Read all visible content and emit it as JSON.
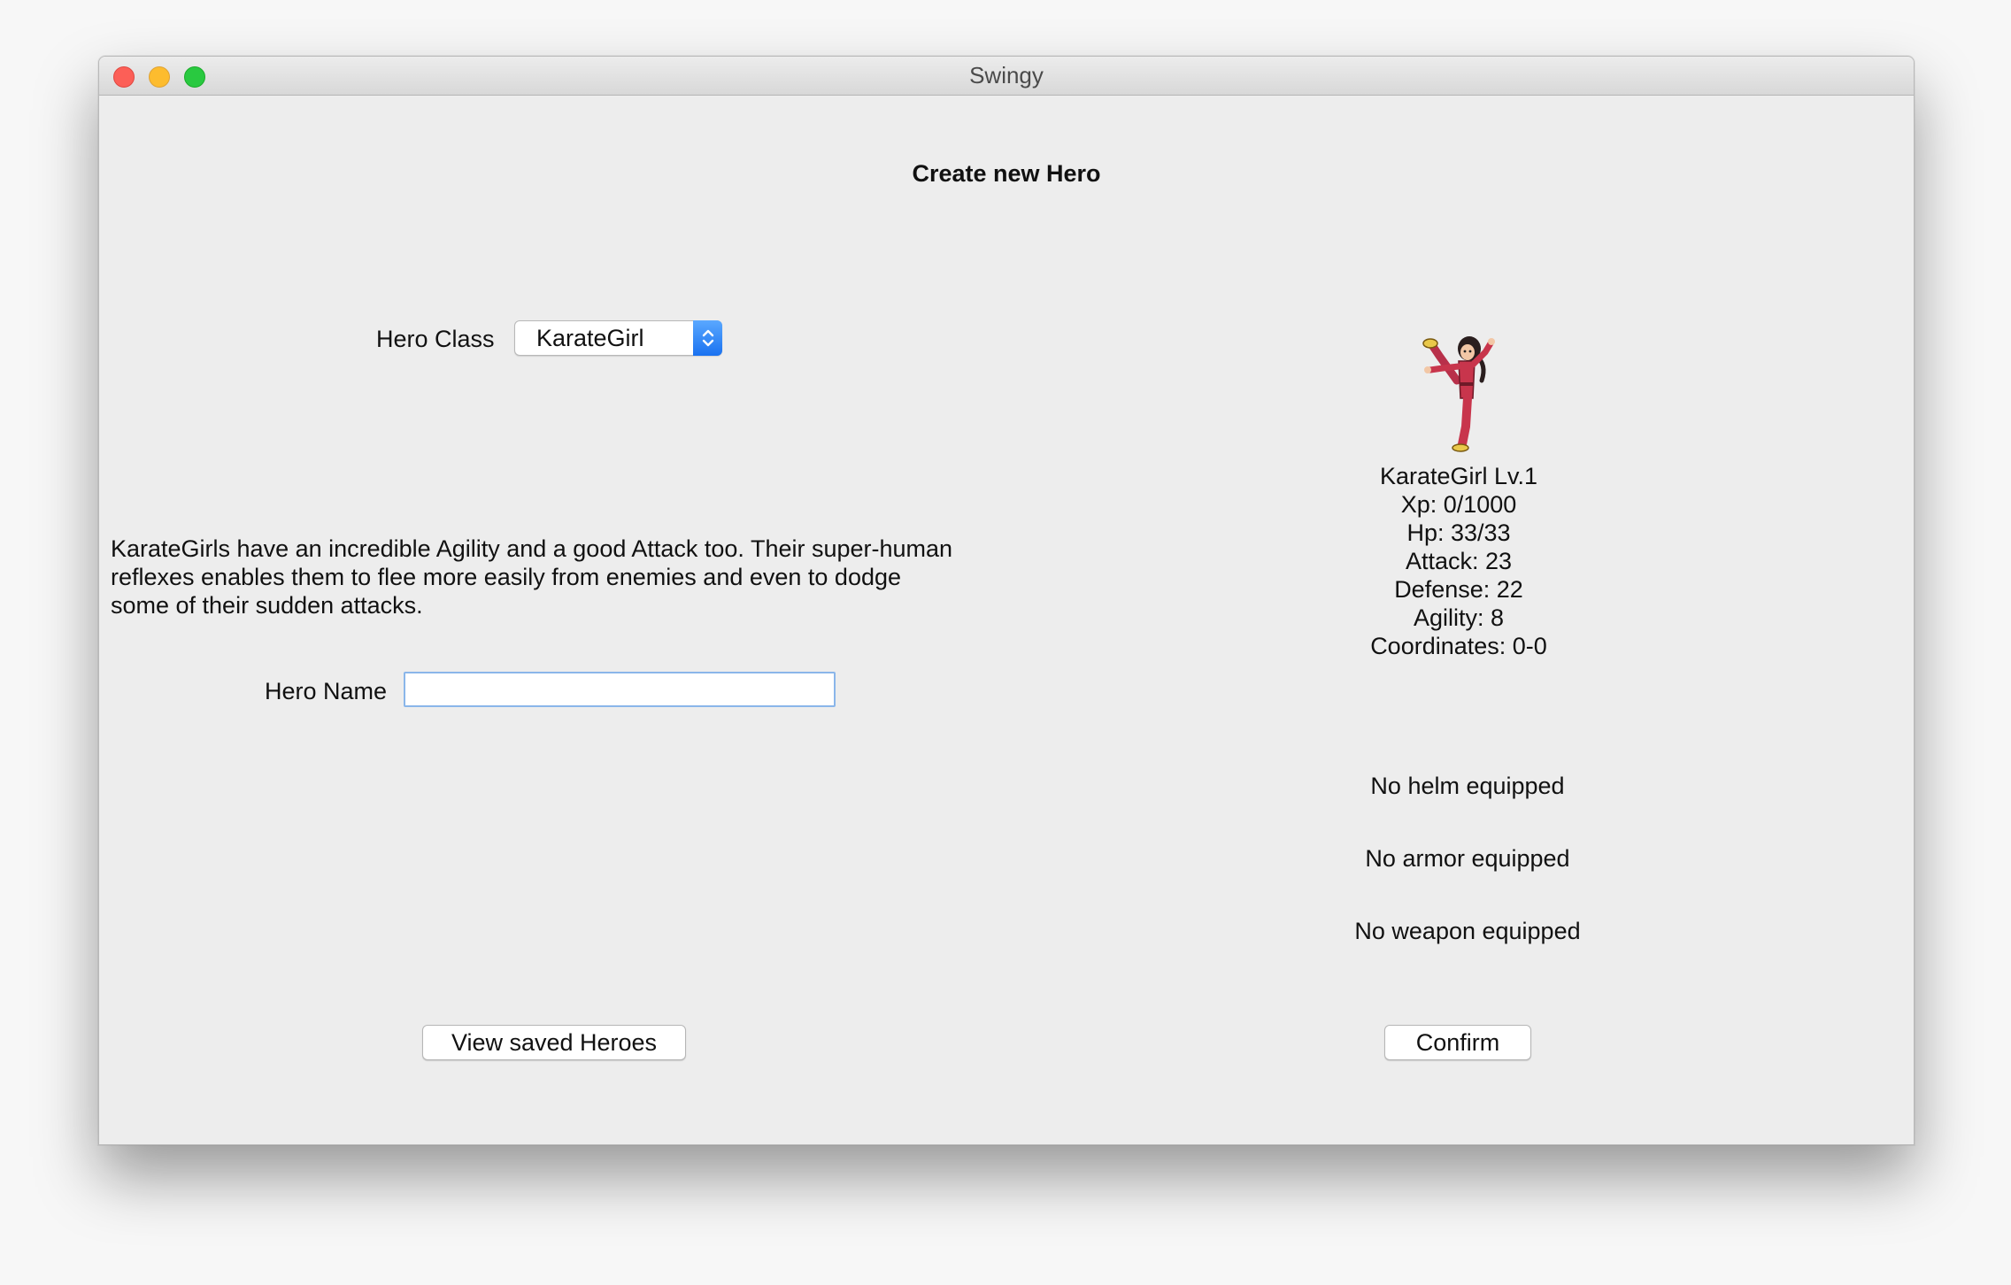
{
  "window": {
    "title": "Swingy"
  },
  "main": {
    "heading": "Create new Hero",
    "hero_class_label": "Hero Class",
    "hero_class_selected": "KarateGirl",
    "description": "KarateGirls have an incredible Agility and a good Attack too. Their super-human reflexes enables them to flee more easily from enemies and even to dodge some of their sudden attacks.",
    "hero_name_label": "Hero Name",
    "hero_name_value": "",
    "view_saved_label": "View saved Heroes",
    "confirm_label": "Confirm"
  },
  "hero": {
    "sprite_icon": "karate-girl-sprite",
    "title": "KarateGirl Lv.1",
    "xp": "Xp: 0/1000",
    "hp": "Hp: 33/33",
    "attack": "Attack: 23",
    "defense": "Defense: 22",
    "agility": "Agility: 8",
    "coordinates": "Coordinates: 0-0"
  },
  "equipment": {
    "helm": "No helm equipped",
    "armor": "No armor equipped",
    "weapon": "No weapon equipped"
  },
  "colors": {
    "close": "#fc5f57",
    "minimize": "#fdbc2e",
    "maximize": "#29c940",
    "select_accent": "#1a72f0",
    "input_focus": "#8ab6ea",
    "outfit": "#c8354c"
  }
}
